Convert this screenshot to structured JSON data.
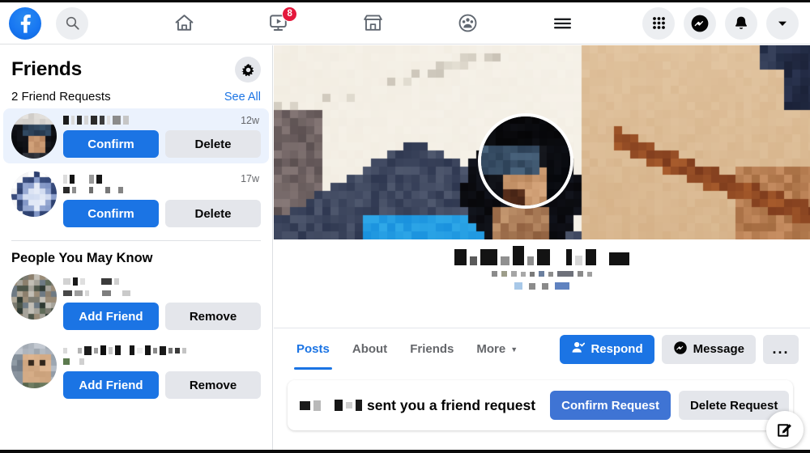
{
  "app": {
    "name": "Facebook",
    "logo_icon": "facebook-logo-icon"
  },
  "topnav": {
    "search_icon": "search-icon",
    "items": [
      {
        "icon": "home-icon",
        "label": "Home",
        "badge": ""
      },
      {
        "icon": "video-watch-icon",
        "label": "Watch",
        "badge": "8"
      },
      {
        "icon": "marketplace-store-icon",
        "label": "Marketplace",
        "badge": ""
      },
      {
        "icon": "groups-icon",
        "label": "Groups",
        "badge": ""
      },
      {
        "icon": "menu-hamburger-icon",
        "label": "Menu",
        "badge": ""
      }
    ],
    "right_items": [
      {
        "icon": "apps-grid-icon",
        "label": "Menu"
      },
      {
        "icon": "messenger-icon",
        "label": "Messenger"
      },
      {
        "icon": "bell-notifications-icon",
        "label": "Notifications"
      },
      {
        "icon": "chevron-down-icon",
        "label": "Account"
      }
    ],
    "badge_color": "#e4183c"
  },
  "sidebar": {
    "title": "Friends",
    "settings_icon": "gear-icon",
    "requests_label": "2 Friend Requests",
    "see_all_label": "See All",
    "requests": [
      {
        "avatar_icon": "user-avatar",
        "name_redacted": true,
        "time": "12w",
        "confirm_label": "Confirm",
        "delete_label": "Delete",
        "selected": true
      },
      {
        "avatar_icon": "user-avatar",
        "name_redacted": true,
        "time": "17w",
        "confirm_label": "Confirm",
        "delete_label": "Delete",
        "selected": false
      }
    ],
    "suggestions_title": "People You May Know",
    "suggestions": [
      {
        "avatar_icon": "user-avatar",
        "name_redacted": true,
        "add_label": "Add Friend",
        "remove_label": "Remove"
      },
      {
        "avatar_icon": "user-avatar",
        "name_redacted": true,
        "add_label": "Add Friend",
        "remove_label": "Remove"
      }
    ]
  },
  "profile": {
    "cover_photo": "cover-photo-pixelated",
    "profile_photo": "profile-photo-pixelated",
    "name_redacted": true,
    "tabs": [
      {
        "label": "Posts",
        "selected": true
      },
      {
        "label": "About",
        "selected": false
      },
      {
        "label": "Friends",
        "selected": false
      },
      {
        "label": "More",
        "selected": false,
        "chevron": "chevron-down-icon"
      }
    ],
    "actions": [
      {
        "label": "Respond",
        "icon": "person-check-icon",
        "style": "primary"
      },
      {
        "label": "Message",
        "icon": "messenger-icon",
        "style": "grey"
      },
      {
        "label": "...",
        "icon": "more-dots-icon",
        "style": "dots"
      }
    ]
  },
  "request_banner": {
    "name_redacted": true,
    "text": "sent you a friend request",
    "confirm_label": "Confirm Request",
    "delete_label": "Delete Request"
  },
  "fab": {
    "icon": "compose-edit-icon",
    "label": "Create"
  },
  "colors": {
    "accent": "#1b74e4",
    "grey_button": "#e4e6eb",
    "badge_red": "#e4183c",
    "selected_row": "#ebf2fd",
    "text_primary": "#050505",
    "text_secondary": "#65676b"
  }
}
